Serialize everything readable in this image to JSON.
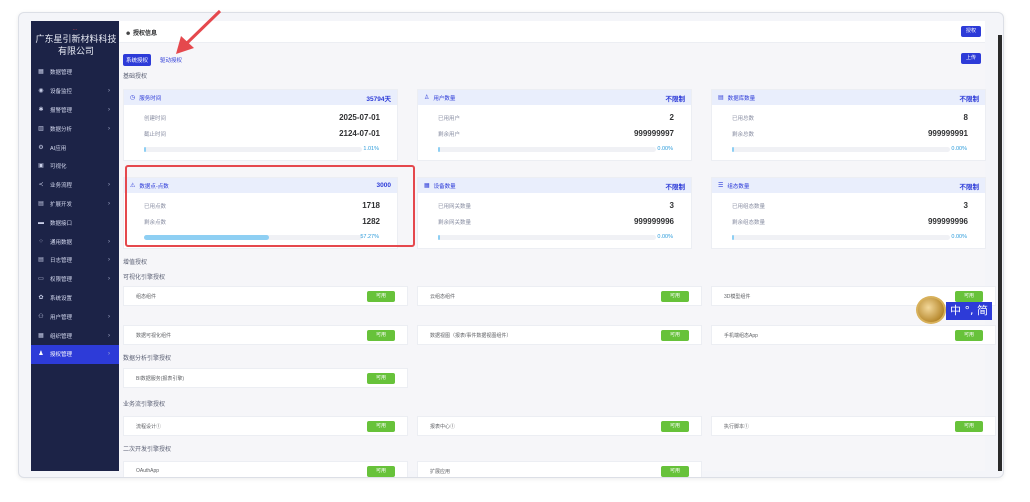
{
  "sidebar": {
    "logo_text": "...",
    "company": "广东星引新材料科技有限公司",
    "items": [
      {
        "label": "数据管理",
        "icon": "grid-icon",
        "arrow": false,
        "active": false
      },
      {
        "label": "设备监控",
        "icon": "monitor-icon",
        "arrow": true,
        "active": false
      },
      {
        "label": "报警管理",
        "icon": "bell-icon",
        "arrow": true,
        "active": false
      },
      {
        "label": "数据分析",
        "icon": "chart-icon",
        "arrow": true,
        "active": false
      },
      {
        "label": "AI应用",
        "icon": "ai-icon",
        "arrow": false,
        "active": false
      },
      {
        "label": "可视化",
        "icon": "screen-icon",
        "arrow": false,
        "active": false
      },
      {
        "label": "业务流程",
        "icon": "share-icon",
        "arrow": true,
        "active": false
      },
      {
        "label": "扩展开发",
        "icon": "code-icon",
        "arrow": true,
        "active": false
      },
      {
        "label": "数据接口",
        "icon": "api-icon",
        "arrow": false,
        "active": false
      },
      {
        "label": "通用数据",
        "icon": "apps-icon",
        "arrow": true,
        "active": false
      },
      {
        "label": "日志管理",
        "icon": "log-icon",
        "arrow": true,
        "active": false
      },
      {
        "label": "权限管理",
        "icon": "lock-icon",
        "arrow": true,
        "active": false
      },
      {
        "label": "系统设置",
        "icon": "gear-icon",
        "arrow": false,
        "active": false
      },
      {
        "label": "用户管理",
        "icon": "users-icon",
        "arrow": true,
        "active": false
      },
      {
        "label": "组织管理",
        "icon": "org-icon",
        "arrow": true,
        "active": false
      },
      {
        "label": "授权管理",
        "icon": "person-icon",
        "arrow": true,
        "active": true
      }
    ]
  },
  "header": {
    "title": "授权信息",
    "action_label": "授权"
  },
  "tabs": [
    {
      "label": "系统授权",
      "active": true
    },
    {
      "label": "驱动授权",
      "active": false
    }
  ],
  "upload_label": "上传",
  "sections": {
    "basic": "基础授权",
    "value_added": "增值授权",
    "group1": "可视化引擎授权",
    "group2": "数据分析引擎授权",
    "group3": "业务流引擎授权",
    "group4": "二次开发引擎授权"
  },
  "cards": [
    {
      "title": "服务时间",
      "value": "35794天",
      "icon": "clock-icon",
      "rows": [
        {
          "label": "创建时间",
          "value": "2025-07-01"
        },
        {
          "label": "截止时间",
          "value": "2124-07-01"
        }
      ],
      "progress_pct": "1.01%",
      "progress": 0.0101
    },
    {
      "title": "用户数量",
      "value": "不限制",
      "icon": "user-icon",
      "rows": [
        {
          "label": "已用用户",
          "value": "2"
        },
        {
          "label": "剩余用户",
          "value": "999999997"
        }
      ],
      "progress_pct": "0.00%",
      "progress": 0
    },
    {
      "title": "数据库数量",
      "value": "不限制",
      "icon": "database-icon",
      "rows": [
        {
          "label": "已用总数",
          "value": "8"
        },
        {
          "label": "剩余总数",
          "value": "999999991"
        }
      ],
      "progress_pct": "0.00%",
      "progress": 0
    },
    {
      "title": "数据点-点数",
      "value": "3000",
      "icon": "point-icon",
      "rows": [
        {
          "label": "已用点数",
          "value": "1718"
        },
        {
          "label": "剩余点数",
          "value": "1282"
        }
      ],
      "progress_pct": "57.27%",
      "progress": 0.5727
    },
    {
      "title": "设备数量",
      "value": "不限制",
      "icon": "device-icon",
      "rows": [
        {
          "label": "已用网关数量",
          "value": "3"
        },
        {
          "label": "剩余网关数量",
          "value": "999999996"
        }
      ],
      "progress_pct": "0.00%",
      "progress": 0
    },
    {
      "title": "组态数量",
      "value": "不限制",
      "icon": "list-icon",
      "rows": [
        {
          "label": "已用组态数量",
          "value": "3"
        },
        {
          "label": "剩余组态数量",
          "value": "999999996"
        }
      ],
      "progress_pct": "0.00%",
      "progress": 0
    }
  ],
  "modules": {
    "group1": [
      {
        "name": "组态组件",
        "status": "可用"
      },
      {
        "name": "云组态组件",
        "status": "可用"
      },
      {
        "name": "3D模型组件",
        "status": "可用"
      },
      {
        "name": "数据可视化组件",
        "status": "可用"
      },
      {
        "name": "数据视图（报表/事件数据视图组件）",
        "status": "可用"
      },
      {
        "name": "手机端组态App",
        "status": "可用"
      }
    ],
    "group2": [
      {
        "name": "BI数据服务(报表引擎)",
        "status": "可用"
      }
    ],
    "group3": [
      {
        "name": "流程设计①",
        "status": "可用"
      },
      {
        "name": "报表中心①",
        "status": "可用"
      },
      {
        "name": "执行脚本①",
        "status": "可用"
      }
    ],
    "group4": [
      {
        "name": "OAuthApp",
        "status": "可用"
      },
      {
        "name": "扩展应用",
        "status": "可用"
      }
    ]
  },
  "ime": {
    "text": "中 °, 简"
  }
}
